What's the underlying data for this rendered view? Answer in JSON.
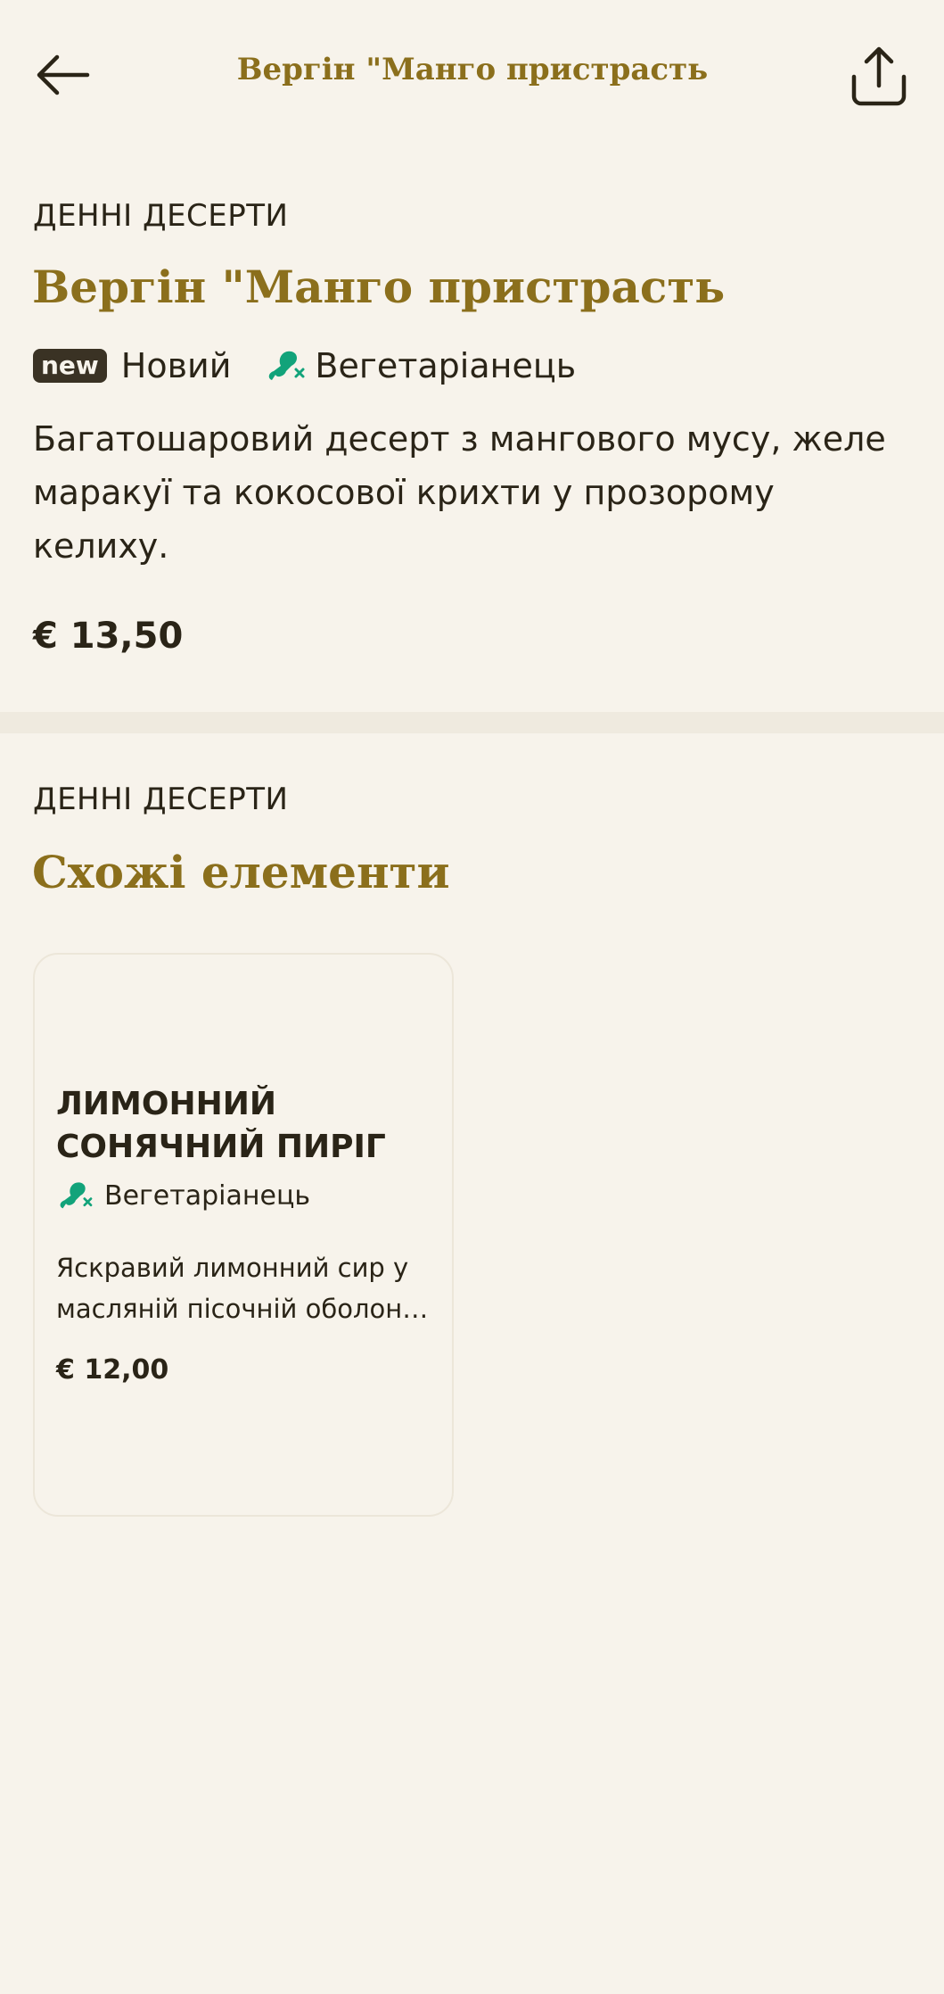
{
  "header": {
    "title": "Вергін \"Манго пристрасть",
    "back_icon": "arrow-left-icon",
    "share_icon": "share-icon"
  },
  "item": {
    "category": "ДЕННІ ДЕСЕРТИ",
    "name": "Вергін \"Манго пристрасть",
    "badge_new": "new",
    "tag_new": "Новий",
    "tag_veg": "Вегетаріанець",
    "description": "Багатошаровий десерт з мангового мусу, желе маракуї та кокосової крихти у прозорому келиху.",
    "price": "€ 13,50"
  },
  "related": {
    "category": "ДЕННІ ДЕСЕРТИ",
    "title": "Схожі елементи",
    "items": [
      {
        "name": "ЛИМОННИЙ СОНЯЧНИЙ ПИРІГ",
        "tag": "Вегетаріанець",
        "description_line1": "Яскравий лимонний сир у",
        "description_line2": "масляній пісочній оболонц...",
        "price": "€ 12,00"
      }
    ]
  },
  "colors": {
    "background": "#f7f3eb",
    "accent_gold": "#8b6f1c",
    "text_dark": "#2a2417",
    "veg_green": "#12a37a",
    "badge_dark": "#3a3224"
  }
}
